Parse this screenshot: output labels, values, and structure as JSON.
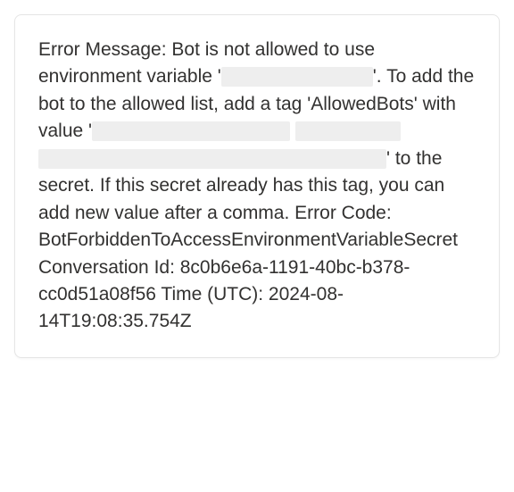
{
  "error": {
    "s1": "Error Message: Bot is not allowed to use environment variable '",
    "s2": "'. To add the bot to the allowed list, add a tag 'AllowedBots' with value '",
    "s3": "' to the secret. If this secret already has this tag, you can add new value after a comma. Error Code: BotForbiddenToAccessEnvironmentVariableSecret Conversation Id: 8c0b6e6a-1191-40bc-b378-cc0d51a08f56 Time (UTC): 2024-08-14T19:08:35.754Z"
  }
}
